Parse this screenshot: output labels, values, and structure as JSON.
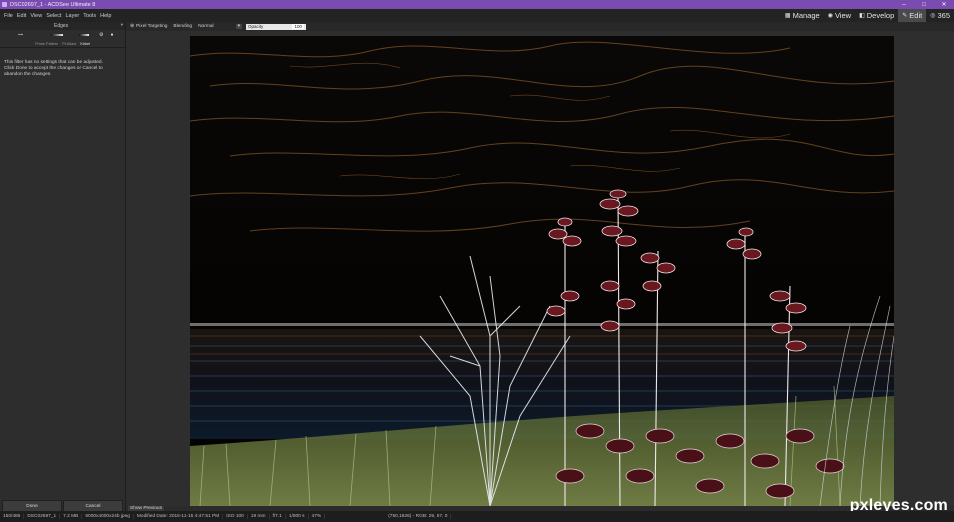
{
  "window": {
    "title": "DSC02697_1 - ACDSee Ultimate 8"
  },
  "menu": [
    "File",
    "Edit",
    "View",
    "Select",
    "Layer",
    "Tools",
    "Help"
  ],
  "mode_tabs": [
    {
      "label": "Manage",
      "icon": "grid-icon"
    },
    {
      "label": "View",
      "icon": "eye-icon"
    },
    {
      "label": "Develop",
      "icon": "develop-icon"
    },
    {
      "label": "Edit",
      "icon": "edit-icon",
      "active": true
    },
    {
      "label": "365",
      "icon": "cloud-icon"
    }
  ],
  "filter_panel": {
    "title": "Edges",
    "tabs": [
      "Prime Pattern",
      "Pt.Aliant",
      "Kirkel"
    ],
    "message": "This filter has no settings that can be adjusted. Click Done to accept the changes or Cancel to abandon the changes.",
    "done_label": "Done",
    "cancel_label": "Cancel"
  },
  "options_bar": {
    "pixel_targeting": "Pixel Targeting",
    "blending_label": "Blending",
    "blending_value": "Normal",
    "opacity_label": "Opacity",
    "opacity_value": "100"
  },
  "canvas": {
    "show_previous": "Show Previous"
  },
  "watermark": {
    "text": "pxleyes",
    "tld": ".com"
  },
  "status": {
    "index": "150/486",
    "filename": "DSC02697_1",
    "size": "7.2 MB",
    "dims": "6000x4000x24b jpeg",
    "modified": "Modified Date: 2016-11-15 4:47:51 PM",
    "iso": "ISO 100",
    "focal": "19 mm",
    "aperture": "f/7.1",
    "shutter": "1/800 s",
    "zoom": "47%",
    "coords": "(750,1826) - RGB: 29, 57, 0"
  },
  "colors": {
    "titlebar": "#7a4bb0",
    "panel": "#2d2d2d",
    "active_tab": "#4a4a4a"
  }
}
